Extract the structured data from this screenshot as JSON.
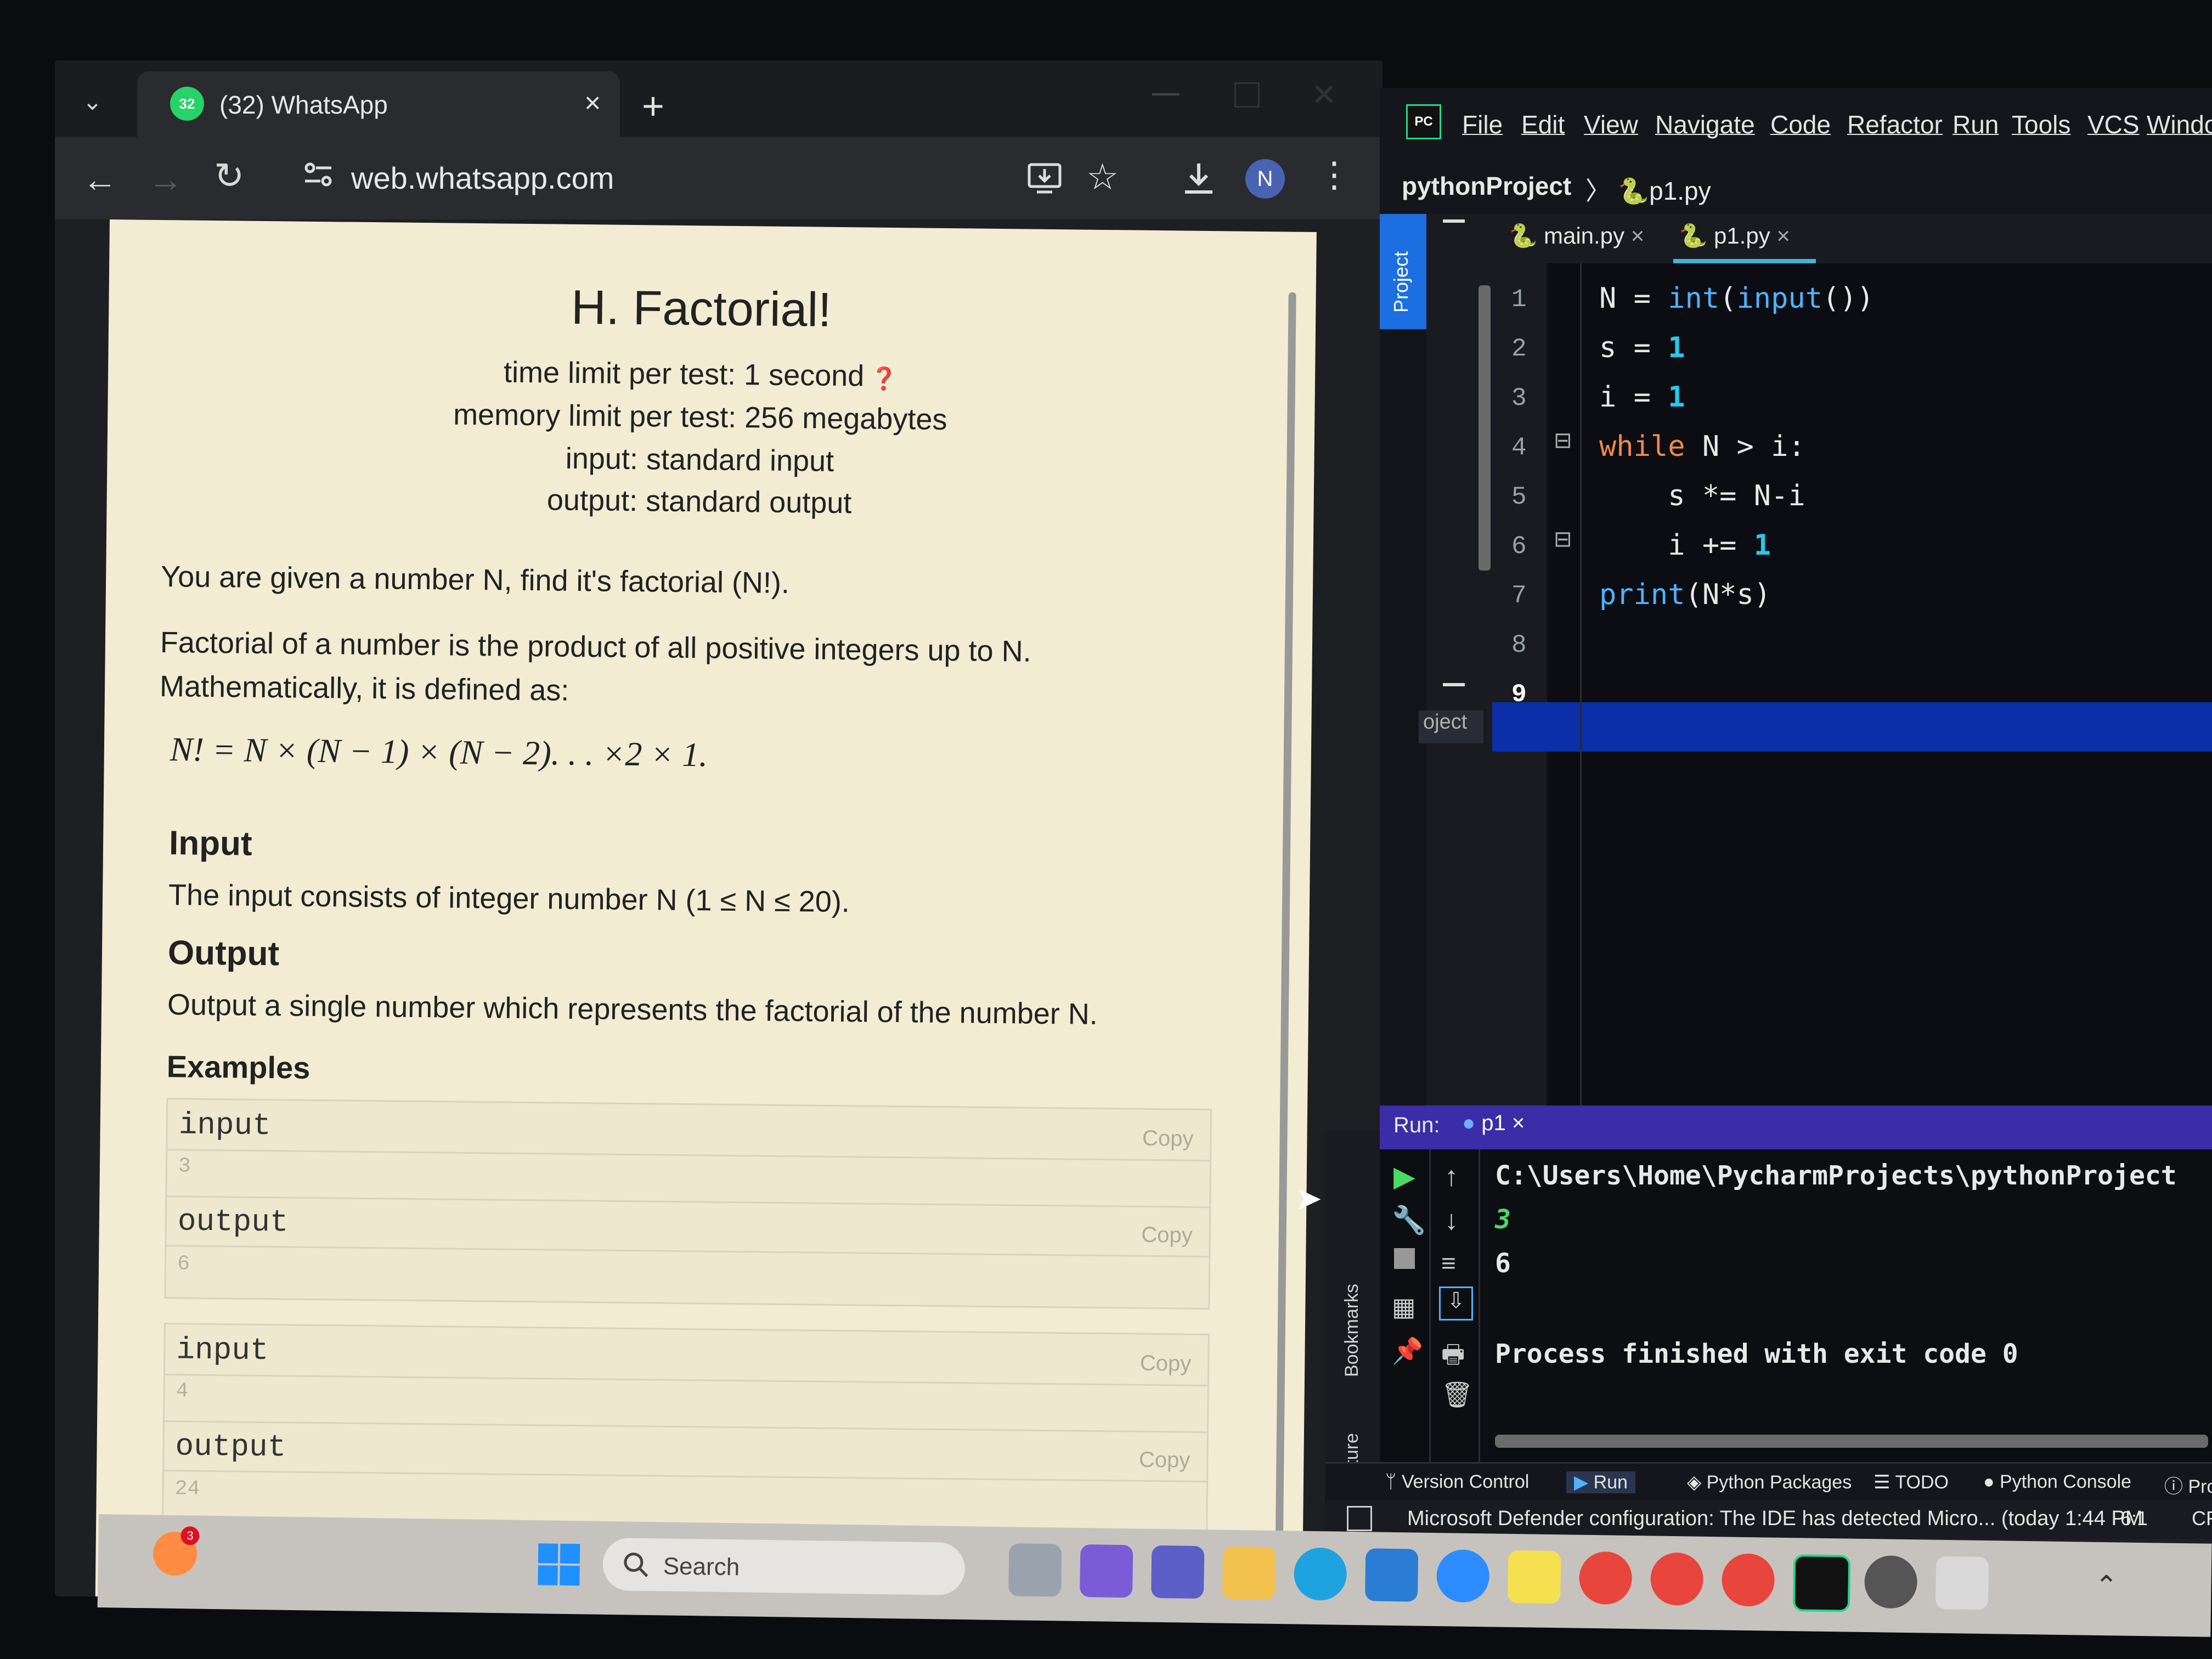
{
  "browser": {
    "tab": {
      "badge": "32",
      "title": "(32) WhatsApp",
      "close": "×"
    },
    "new_tab": "+",
    "url": "web.whatsapp.com",
    "avatar_initial": "N"
  },
  "problem": {
    "title": "H. Factorial!",
    "time_limit": "time limit per test: 1 second",
    "memory_limit": "memory limit per test: 256 megabytes",
    "input": "input: standard input",
    "output": "output: standard output",
    "statement": "You are given a number N, find it's factorial (N!).",
    "definition_1": "Factorial of a number is the product of all positive integers up to N.",
    "definition_2": "Mathematically, it is defined as:",
    "formula": "N! = N × (N − 1) × (N − 2). . . ×2 × 1.",
    "input_heading": "Input",
    "input_spec": "The input consists of integer number N (1 ≤ N ≤ 20).",
    "output_heading": "Output",
    "output_spec": "Output a single number which represents the factorial of the number N.",
    "examples_heading": "Examples",
    "examples": [
      {
        "input_label": "input",
        "input_value": "3",
        "output_label": "output",
        "output_value": "6",
        "copy": "Copy"
      },
      {
        "input_label": "input",
        "input_value": "4",
        "output_label": "output",
        "output_value": "24",
        "copy": "Copy"
      }
    ]
  },
  "ide": {
    "logo": "PC",
    "menu": [
      "File",
      "Edit",
      "View",
      "Navigate",
      "Code",
      "Refactor",
      "Run",
      "Tools",
      "VCS",
      "Windo"
    ],
    "breadcrumb_project": "pythonProject",
    "breadcrumb_file": "p1.py",
    "sidebar_project_label": "Project",
    "panel_label": "oject",
    "tabs": [
      "main.py",
      "p1.py"
    ],
    "tab_close": "×",
    "line_numbers": [
      "1",
      "2",
      "3",
      "4",
      "5",
      "6",
      "7",
      "8",
      "9"
    ],
    "run_label": "Run:",
    "run_tab": "p1",
    "output_path": "C:\\Users\\Home\\PycharmProjects\\pythonProject",
    "output_input": "3",
    "output_result": "6",
    "output_finished": "Process finished with exit code 0",
    "side_bookmarks": "Bookmarks",
    "side_structure": "Structure",
    "tool_tabs": [
      "Version Control",
      "Run",
      "Python Packages",
      "TODO",
      "Python Console",
      "Prob"
    ],
    "status_message": "Microsoft Defender configuration: The IDE has detected Micro... (today 1:44 PM",
    "status_position": "6:1",
    "status_line_ending": "CRLF"
  },
  "taskbar": {
    "weather_badge": "3",
    "search_text": "Search"
  },
  "colors": {
    "page_bg": "#f2ecd3",
    "ide_bg": "#1d1e26",
    "run_header": "#3b2ca8",
    "highlight_line": "#0a2fa8",
    "keyword": "#f08a45",
    "number": "#27c8e8"
  }
}
